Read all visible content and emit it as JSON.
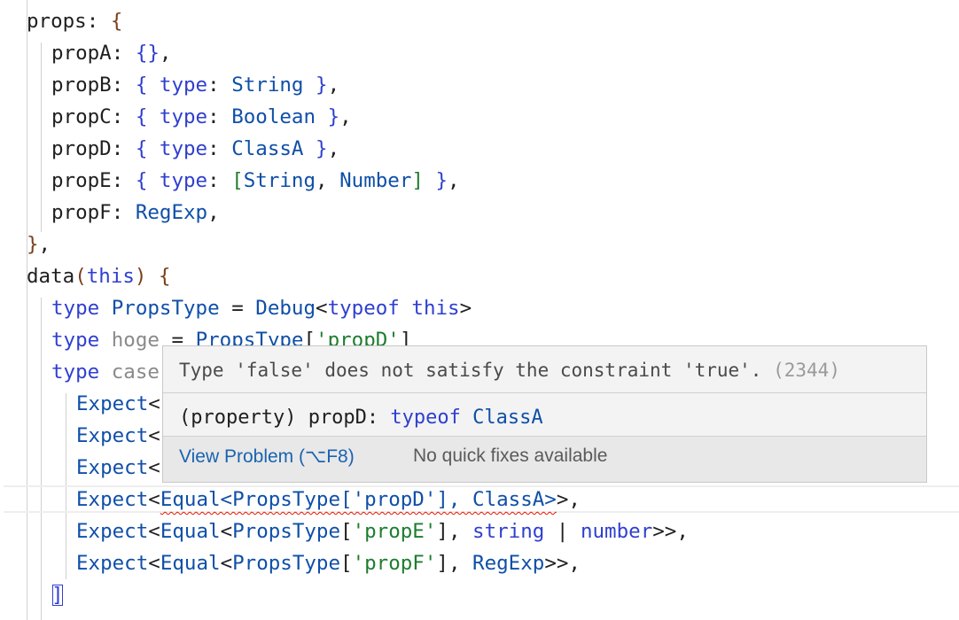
{
  "lines": [
    [
      [
        "props",
        "p"
      ],
      [
        ": ",
        "p"
      ],
      [
        "{",
        "b"
      ]
    ],
    [
      [
        "propA",
        "p"
      ],
      [
        ": ",
        "p"
      ],
      [
        "{}",
        "k"
      ],
      [
        ",",
        "p"
      ]
    ],
    [
      [
        "propB",
        "p"
      ],
      [
        ": ",
        "p"
      ],
      [
        "{ ",
        "k"
      ],
      [
        "type",
        "k"
      ],
      [
        ": ",
        "p"
      ],
      [
        "String",
        "t"
      ],
      [
        " }",
        "k"
      ],
      [
        ",",
        "p"
      ]
    ],
    [
      [
        "propC",
        "p"
      ],
      [
        ": ",
        "p"
      ],
      [
        "{ ",
        "k"
      ],
      [
        "type",
        "k"
      ],
      [
        ": ",
        "p"
      ],
      [
        "Boolean",
        "t"
      ],
      [
        " }",
        "k"
      ],
      [
        ",",
        "p"
      ]
    ],
    [
      [
        "propD",
        "p"
      ],
      [
        ": ",
        "p"
      ],
      [
        "{ ",
        "k"
      ],
      [
        "type",
        "k"
      ],
      [
        ": ",
        "p"
      ],
      [
        "ClassA",
        "t"
      ],
      [
        " }",
        "k"
      ],
      [
        ",",
        "p"
      ]
    ],
    [
      [
        "propE",
        "p"
      ],
      [
        ": ",
        "p"
      ],
      [
        "{ ",
        "k"
      ],
      [
        "type",
        "k"
      ],
      [
        ": ",
        "p"
      ],
      [
        "[",
        "s"
      ],
      [
        "String",
        "t"
      ],
      [
        ", ",
        "p"
      ],
      [
        "Number",
        "t"
      ],
      [
        "]",
        "s"
      ],
      [
        " }",
        "k"
      ],
      [
        ",",
        "p"
      ]
    ],
    [
      [
        "propF",
        "p"
      ],
      [
        ": ",
        "p"
      ],
      [
        "RegExp",
        "t"
      ],
      [
        ",",
        "p"
      ]
    ],
    [
      [
        "}",
        "b"
      ],
      [
        ",",
        "p"
      ]
    ],
    [
      [
        "data",
        "p"
      ],
      [
        "(",
        "b"
      ],
      [
        "this",
        "k"
      ],
      [
        ")",
        "b"
      ],
      [
        " ",
        "p"
      ],
      [
        "{",
        "b"
      ]
    ],
    [
      [
        "type ",
        "k"
      ],
      [
        "PropsType",
        "t"
      ],
      [
        " = ",
        "p"
      ],
      [
        "Debug",
        "t"
      ],
      [
        "<",
        "p"
      ],
      [
        "typeof",
        "k"
      ],
      [
        " ",
        "p"
      ],
      [
        "this",
        "k"
      ],
      [
        ">",
        "p"
      ]
    ],
    [
      [
        "type ",
        "k"
      ],
      [
        "hoge",
        "g"
      ],
      [
        " = ",
        "p"
      ],
      [
        "PropsType",
        "t"
      ],
      [
        "[",
        "p"
      ],
      [
        "'propD'",
        "s"
      ],
      [
        "]",
        "p"
      ]
    ],
    [
      [
        "type ",
        "k"
      ],
      [
        "case",
        "g"
      ]
    ],
    [
      [
        "Expect",
        "t"
      ],
      [
        "<",
        "p"
      ]
    ],
    [
      [
        "Expect",
        "t"
      ],
      [
        "<",
        "p"
      ]
    ],
    [
      [
        "Expect",
        "t"
      ],
      [
        "<",
        "p"
      ]
    ],
    [
      [
        "Expect",
        "t"
      ],
      [
        "<",
        "p"
      ],
      [
        "Equal<PropsType['propD'], ClassA>",
        "t",
        "sq"
      ],
      [
        ">,",
        "p"
      ]
    ],
    [
      [
        "Expect",
        "t"
      ],
      [
        "<",
        "p"
      ],
      [
        "Equal",
        "t"
      ],
      [
        "<",
        "p"
      ],
      [
        "PropsType",
        "t"
      ],
      [
        "[",
        "p"
      ],
      [
        "'propE'",
        "s"
      ],
      [
        "], ",
        "p"
      ],
      [
        "string",
        "k"
      ],
      [
        " | ",
        "p"
      ],
      [
        "number",
        "k"
      ],
      [
        ">>,",
        "p"
      ]
    ],
    [
      [
        "Expect",
        "t"
      ],
      [
        "<",
        "p"
      ],
      [
        "Equal",
        "t"
      ],
      [
        "<",
        "p"
      ],
      [
        "PropsType",
        "t"
      ],
      [
        "[",
        "p"
      ],
      [
        "'propF'",
        "s"
      ],
      [
        "], ",
        "p"
      ],
      [
        "RegExp",
        "t"
      ],
      [
        ">>,",
        "p"
      ]
    ],
    [
      [
        "]",
        "k",
        "bx"
      ]
    ]
  ],
  "hover": {
    "message": "Type 'false' does not satisfy the constraint 'true'.",
    "error_code": "(2344)",
    "sig_prefix": "(property) propD: ",
    "sig_keyword": "typeof",
    "sig_type": "ClassA",
    "view_problem": "View Problem (⌥F8)",
    "no_fixes": "No quick fixes available"
  },
  "colors": {
    "keyword": "#2f3fcf",
    "type": "#0f4fa8",
    "string": "#1d7d2e",
    "brace": "#7a3e1a",
    "plain": "#1f1f1f",
    "error_squiggle": "#e51400",
    "link": "#1a63b0"
  }
}
